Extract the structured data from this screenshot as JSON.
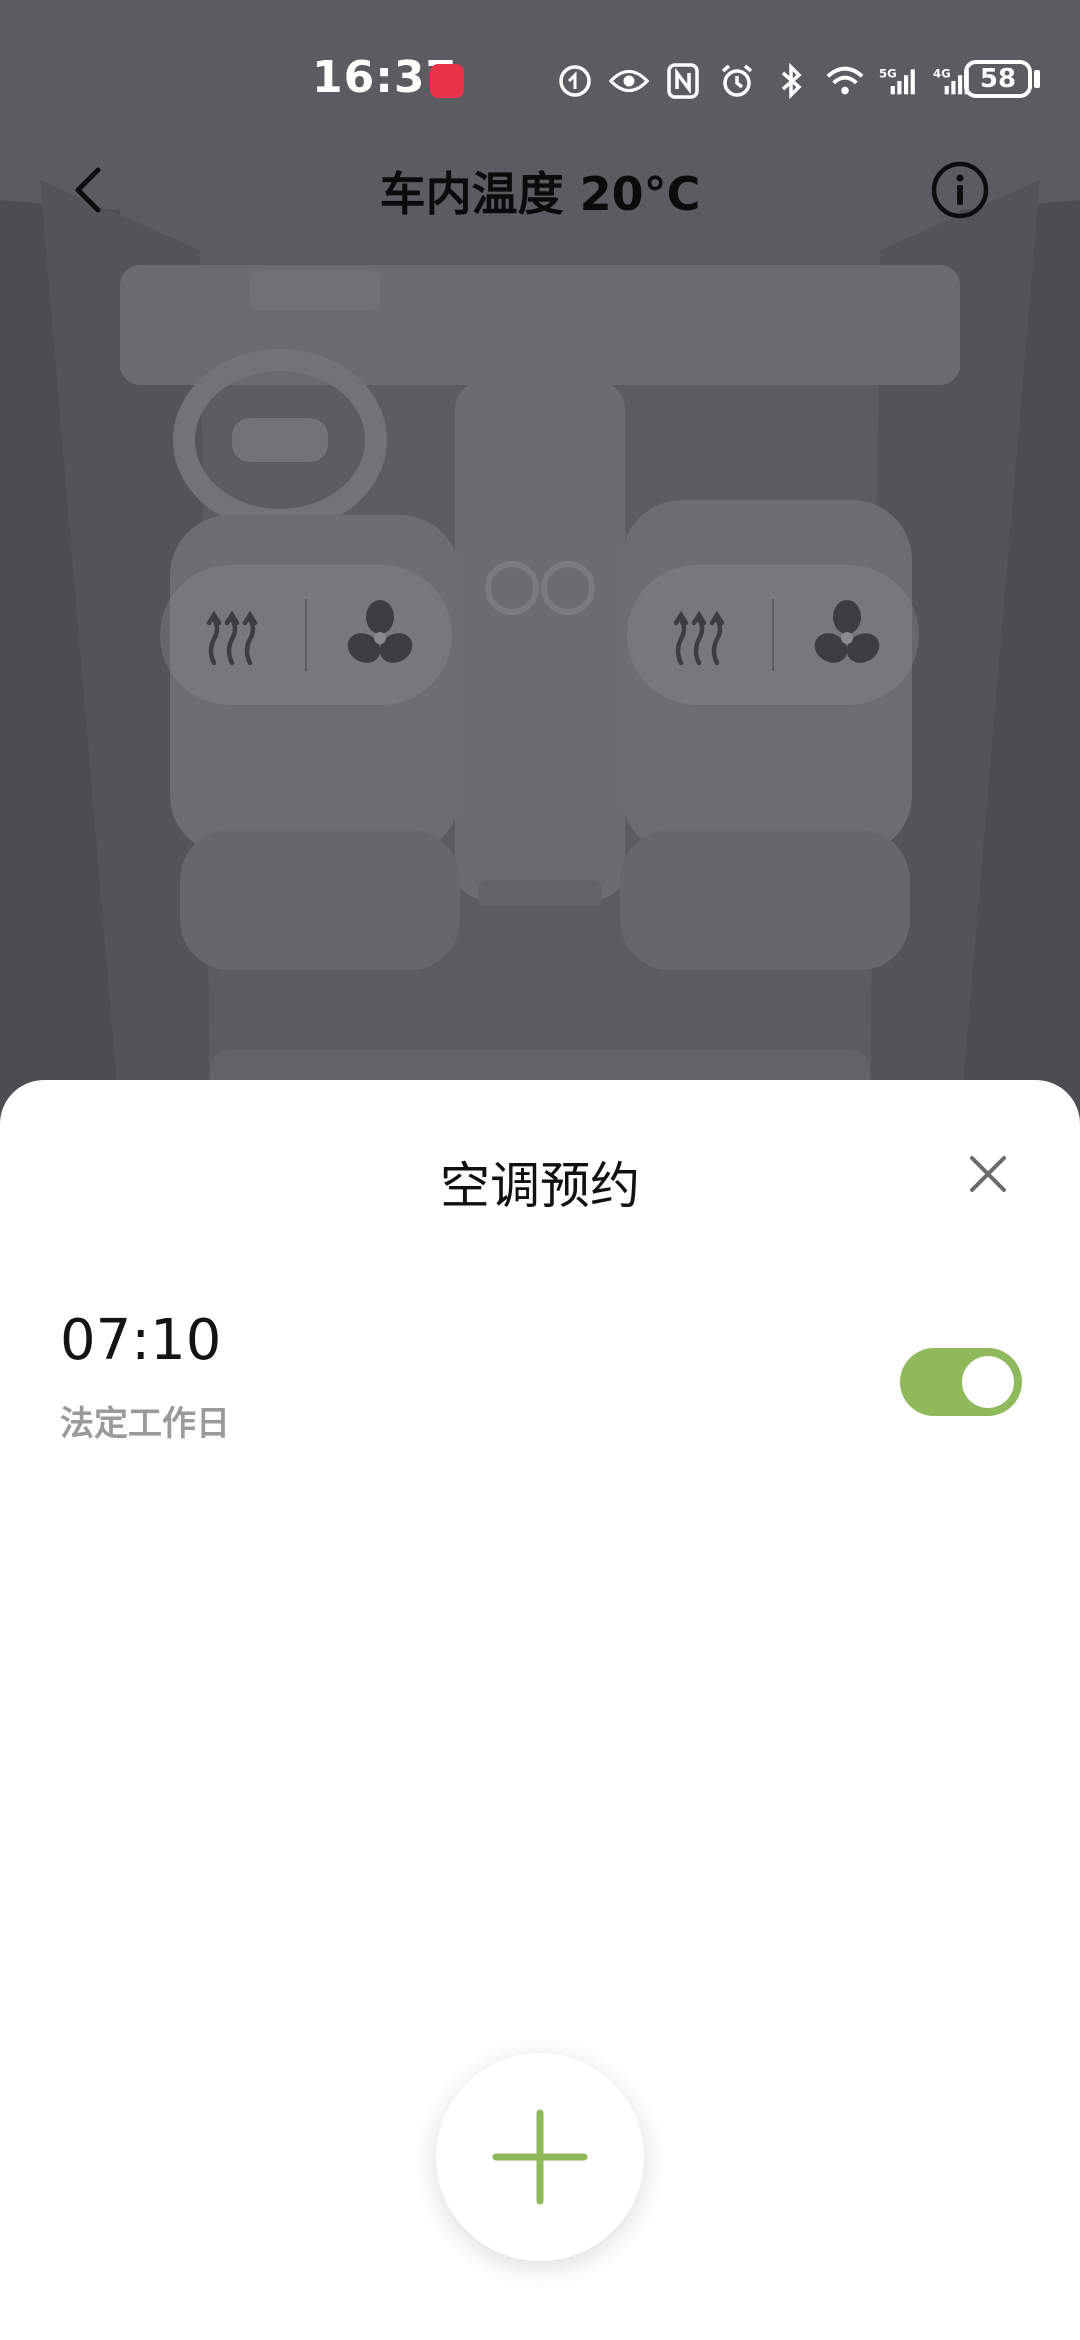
{
  "status_bar": {
    "time": "16:37",
    "battery": "58",
    "icons": [
      "app-notification-icon",
      "eye-icon",
      "nfc-icon",
      "alarm-icon",
      "bluetooth-icon",
      "wifi-icon",
      "signal-5g-icon",
      "signal-4g-icon"
    ]
  },
  "header": {
    "title": "车内温度 20°C"
  },
  "seats": [
    {
      "name": "driver-seat",
      "controls": [
        "seat-heat-icon",
        "seat-fan-icon"
      ]
    },
    {
      "name": "passenger-seat",
      "controls": [
        "seat-heat-icon",
        "seat-fan-icon"
      ]
    }
  ],
  "sheet": {
    "title": "空调预约",
    "schedules": [
      {
        "time": "07:10",
        "repeat": "法定工作日",
        "enabled": true
      }
    ]
  },
  "colors": {
    "accent": "#8fb95a",
    "background_dim": "#5c5d61"
  }
}
